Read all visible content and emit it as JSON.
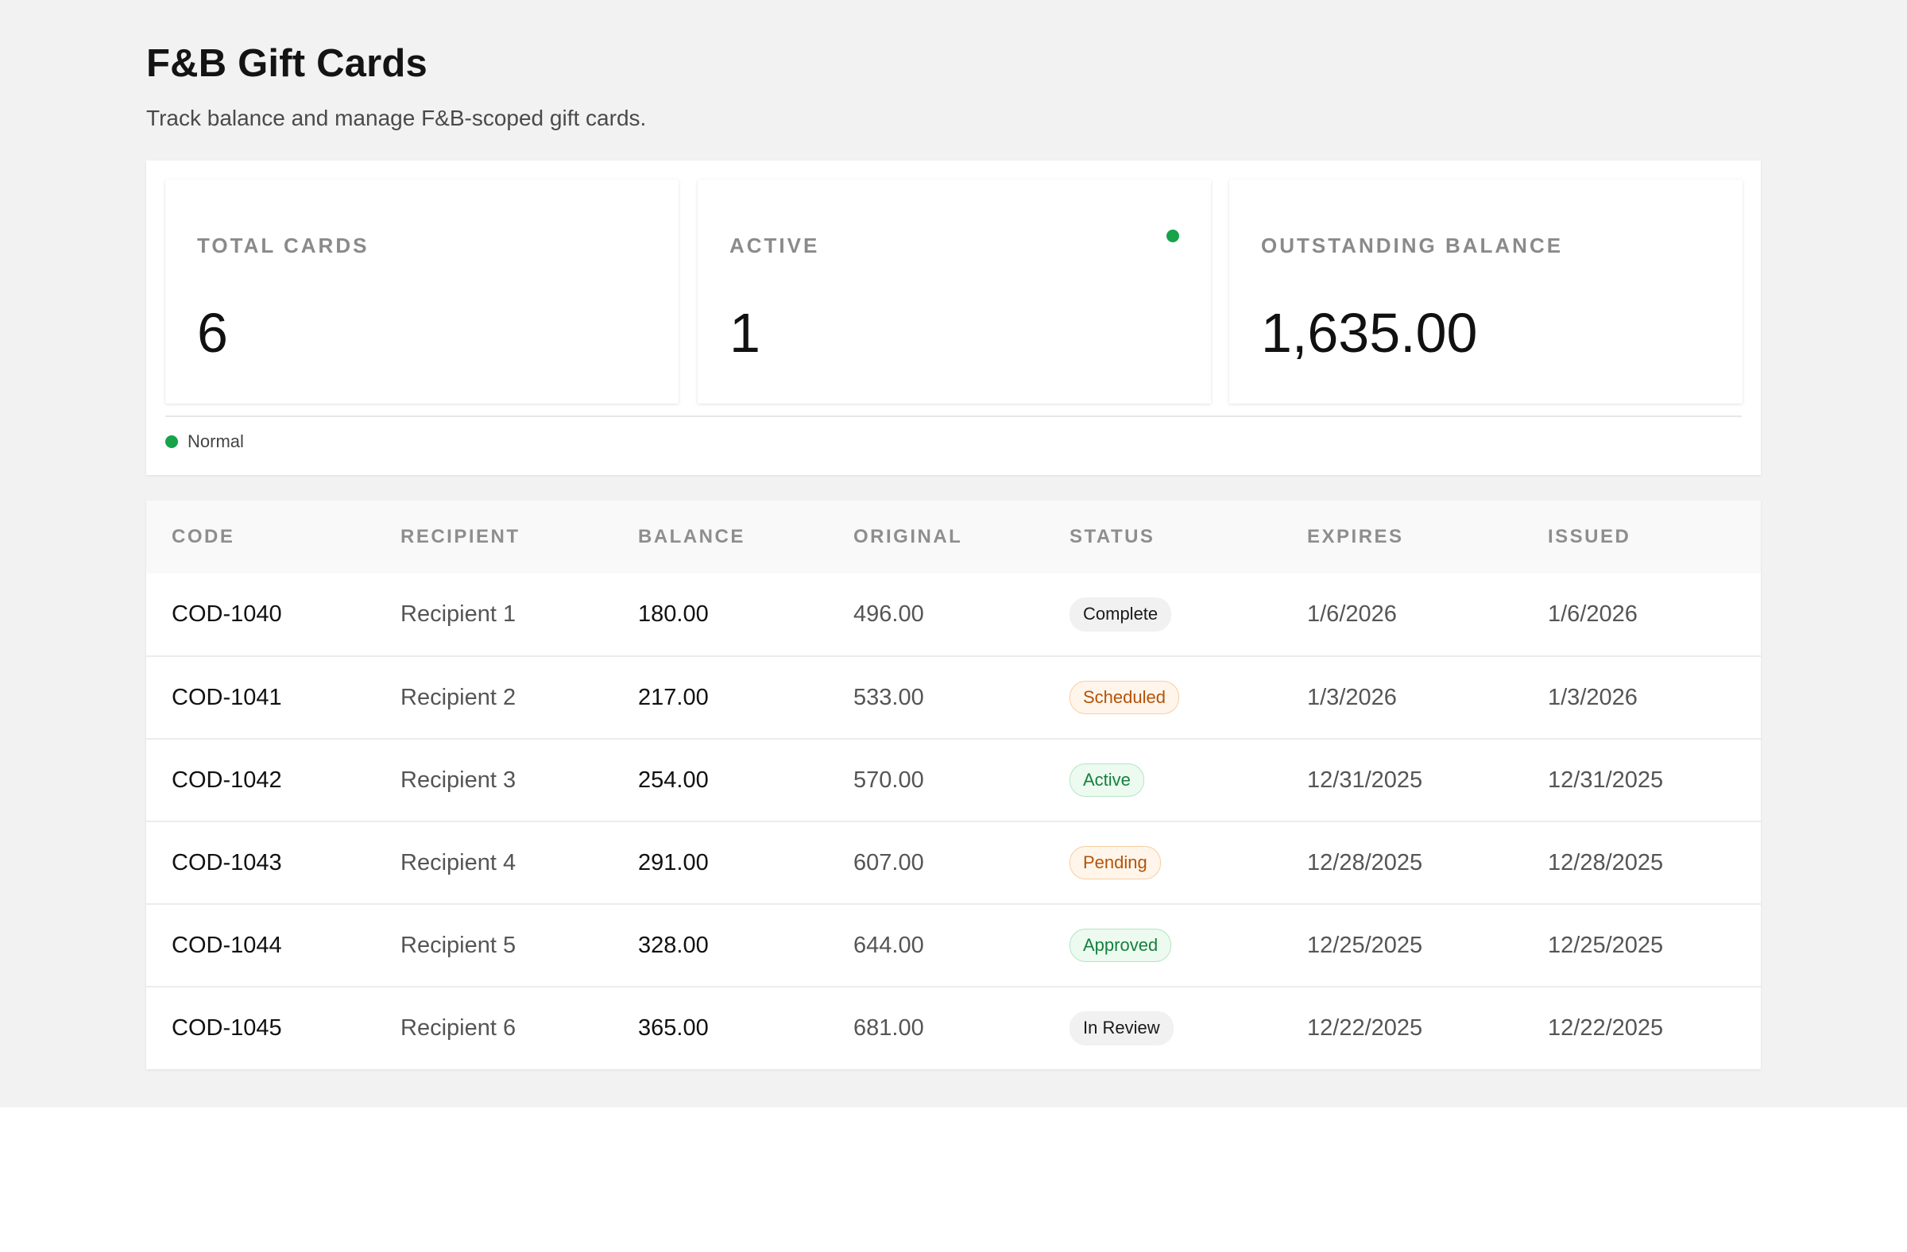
{
  "header": {
    "title": "F&B Gift Cards",
    "subtitle": "Track balance and manage F&B-scoped gift cards."
  },
  "stats": [
    {
      "label": "Total Cards",
      "value": "6"
    },
    {
      "label": "Active",
      "value": "1",
      "indicator_color": "#16a34a"
    },
    {
      "label": "Outstanding Balance",
      "value": "1,635.00"
    }
  ],
  "legend": {
    "label": "Normal",
    "color": "#16a34a"
  },
  "table": {
    "columns": [
      "CODE",
      "RECIPIENT",
      "BALANCE",
      "ORIGINAL",
      "STATUS",
      "EXPIRES",
      "ISSUED"
    ],
    "rows": [
      {
        "code": "COD-1040",
        "recipient": "Recipient 1",
        "balance": "180.00",
        "original": "496.00",
        "status": "Complete",
        "status_tone": "neutral",
        "expires": "1/6/2026",
        "issued": "1/6/2026"
      },
      {
        "code": "COD-1041",
        "recipient": "Recipient 2",
        "balance": "217.00",
        "original": "533.00",
        "status": "Scheduled",
        "status_tone": "orange",
        "expires": "1/3/2026",
        "issued": "1/3/2026"
      },
      {
        "code": "COD-1042",
        "recipient": "Recipient 3",
        "balance": "254.00",
        "original": "570.00",
        "status": "Active",
        "status_tone": "green",
        "expires": "12/31/2025",
        "issued": "12/31/2025"
      },
      {
        "code": "COD-1043",
        "recipient": "Recipient 4",
        "balance": "291.00",
        "original": "607.00",
        "status": "Pending",
        "status_tone": "orange",
        "expires": "12/28/2025",
        "issued": "12/28/2025"
      },
      {
        "code": "COD-1044",
        "recipient": "Recipient 5",
        "balance": "328.00",
        "original": "644.00",
        "status": "Approved",
        "status_tone": "green",
        "expires": "12/25/2025",
        "issued": "12/25/2025"
      },
      {
        "code": "COD-1045",
        "recipient": "Recipient 6",
        "balance": "365.00",
        "original": "681.00",
        "status": "In Review",
        "status_tone": "neutral",
        "expires": "12/22/2025",
        "issued": "12/22/2025"
      }
    ]
  }
}
